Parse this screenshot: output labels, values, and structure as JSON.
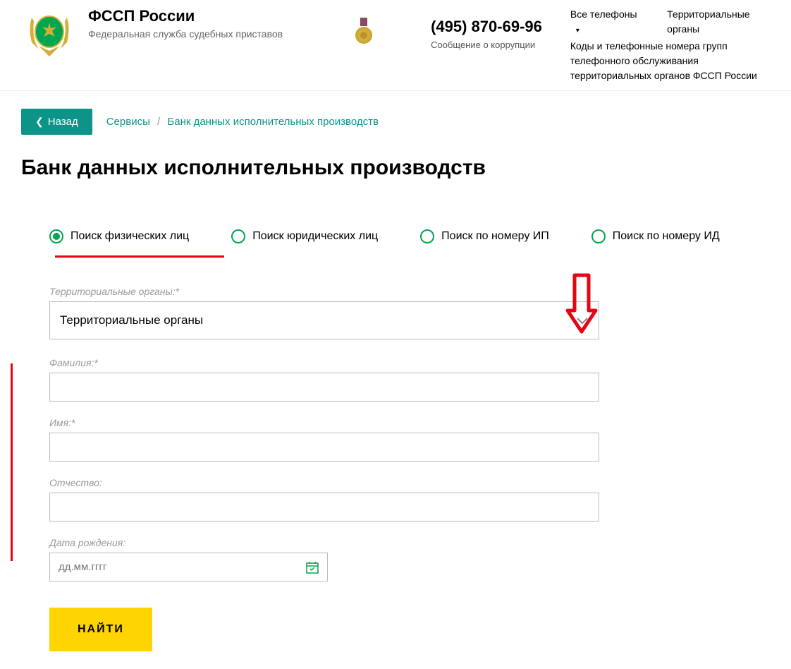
{
  "header": {
    "org_title": "ФССП России",
    "org_sub": "Федеральная служба судебных приставов",
    "phone": "(495) 870-69-96",
    "phone_sub": "Сообщение о коррупции",
    "link_all_phones": "Все телефоны",
    "link_territorial": "Территориальные органы",
    "link_codes": "Коды и телефонные номера групп телефонного обслуживания территориальных органов ФССП России"
  },
  "nav": {
    "back": "Назад",
    "crumb1": "Сервисы",
    "crumb2": "Банк данных исполнительных производств"
  },
  "page_title": "Банк данных исполнительных производств",
  "tabs": {
    "t1": "Поиск физических лиц",
    "t2": "Поиск юридических лиц",
    "t3": "Поиск по номеру ИП",
    "t4": "Поиск по номеру ИД"
  },
  "form": {
    "territory_label": "Территориальные органы:*",
    "territory_value": "Территориальные органы",
    "surname_label": "Фамилия:*",
    "name_label": "Имя:*",
    "patronymic_label": "Отчество:",
    "birthdate_label": "Дата рождения:",
    "birthdate_placeholder": "дд.мм.гггг",
    "submit": "НАЙТИ"
  }
}
